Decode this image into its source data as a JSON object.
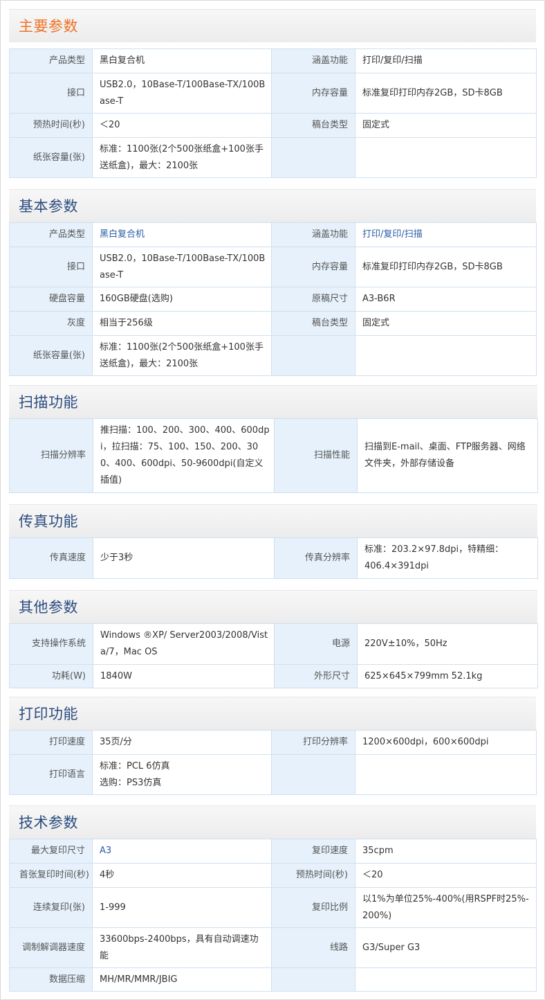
{
  "sections": [
    {
      "title": "主要参数",
      "rows": [
        {
          "l1": "产品类型",
          "v1": "黑白复合机",
          "l2": "涵盖功能",
          "v2": "打印/复印/扫描"
        },
        {
          "l1": "接口",
          "v1": "USB2.0，10Base-T/100Base-TX/100Base-T",
          "l2": "内存容量",
          "v2": "标准复印打印内存2GB，SD卡8GB"
        },
        {
          "l1": "预热时间(秒)",
          "v1": "＜20",
          "l2": "稿台类型",
          "v2": "固定式"
        },
        {
          "l1": "纸张容量(张)",
          "v1": "标准：1100张(2个500张纸盒+100张手送纸盒)，最大：2100张",
          "l2": "",
          "v2": ""
        }
      ]
    },
    {
      "title": "基本参数",
      "rows": [
        {
          "l1": "产品类型",
          "v1": "黑白复合机",
          "l2": "涵盖功能",
          "v2": "打印/复印/扫描"
        },
        {
          "l1": "接口",
          "v1": "USB2.0，10Base-T/100Base-TX/100Base-T",
          "l2": "内存容量",
          "v2": "标准复印打印内存2GB，SD卡8GB"
        },
        {
          "l1": "硬盘容量",
          "v1": "160GB硬盘(选购)",
          "l2": "原稿尺寸",
          "v2": "A3-B6R"
        },
        {
          "l1": "灰度",
          "v1": "相当于256级",
          "l2": "稿台类型",
          "v2": "固定式"
        },
        {
          "l1": "纸张容量(张)",
          "v1": "标准：1100张(2个500张纸盒+100张手送纸盒)，最大：2100张",
          "l2": "",
          "v2": ""
        }
      ]
    },
    {
      "title": "扫描功能",
      "rows": [
        {
          "l1": "扫描分辨率",
          "v1": "推扫描：100、200、300、400、600dpi，拉扫描：75、100、150、200、300、400、600dpi、50-9600dpi(自定义插值)",
          "l2": "扫描性能",
          "v2": "扫描到E-mail、桌面、FTP服务器、网络文件夹，外部存储设备"
        }
      ]
    },
    {
      "title": "传真功能",
      "rows": [
        {
          "l1": "传真速度",
          "v1": "少于3秒",
          "l2": "传真分辨率",
          "v2": "标准：203.2×97.8dpi，特精细：406.4×391dpi"
        }
      ]
    },
    {
      "title": "其他参数",
      "rows": [
        {
          "l1": "支持操作系统",
          "v1": "Windows ®XP/ Server2003/2008/Vista/7，Mac OS",
          "l2": "电源",
          "v2": "220V±10%，50Hz"
        },
        {
          "l1": "功耗(W)",
          "v1": "1840W",
          "l2": "外形尺寸",
          "v2": "625×645×799mm 52.1kg"
        }
      ]
    },
    {
      "title": "打印功能",
      "rows": [
        {
          "l1": "打印速度",
          "v1": "35页/分",
          "l2": "打印分辨率",
          "v2": "1200×600dpi，600×600dpi"
        },
        {
          "l1": "打印语言",
          "v1a": "标准：PCL 6仿真",
          "v1b": "选购：PS3仿真",
          "l2": "",
          "v2": ""
        }
      ]
    },
    {
      "title": "技术参数",
      "rows": [
        {
          "l1": "最大复印尺寸",
          "v1": "A3",
          "l2": "复印速度",
          "v2": "35cpm"
        },
        {
          "l1": "首张复印时间(秒)",
          "v1": "4秒",
          "l2": "预热时间(秒)",
          "v2": "＜20"
        },
        {
          "l1": "连续复印(张)",
          "v1": "1-999",
          "l2": "复印比例",
          "v2": "以1%为单位25%-400%(用RSPF时25%-200%)"
        },
        {
          "l1": "调制解调器速度",
          "v1": "33600bps-2400bps，具有自动调速功能",
          "l2": "线路",
          "v2": "G3/Super G3"
        },
        {
          "l1": "数据压缩",
          "v1": "MH/MR/MMR/JBIG",
          "l2": "",
          "v2": ""
        }
      ]
    }
  ]
}
